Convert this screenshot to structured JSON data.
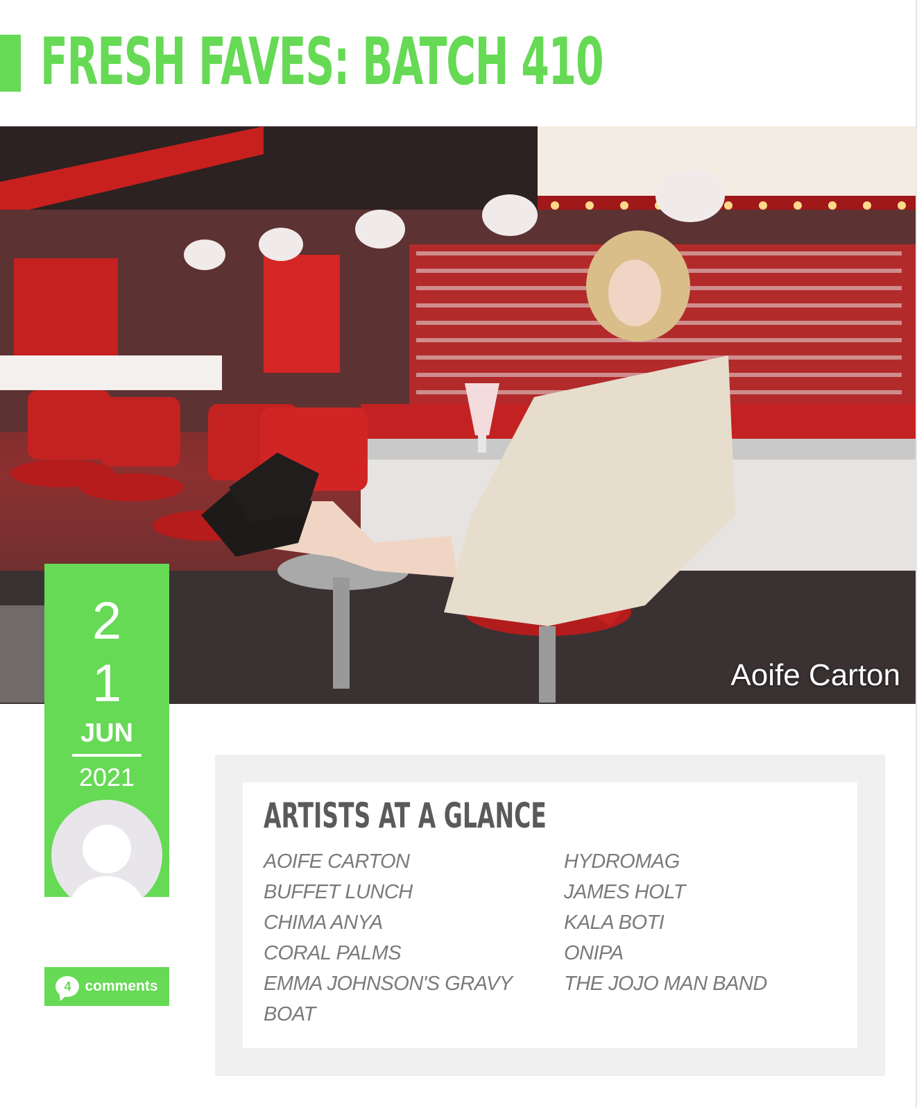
{
  "header": {
    "title": "Fresh Faves: Batch 410"
  },
  "hero": {
    "caption": "Aoife Carton"
  },
  "date": {
    "day_digit_1": "2",
    "day_digit_2": "1",
    "month": "JUN",
    "year": "2021"
  },
  "comments": {
    "count": "4",
    "label": "comments"
  },
  "artists": {
    "title": "Artists at a glance",
    "left": [
      "Aoife Carton",
      "Buffet Lunch",
      "Chima Anya",
      "Coral Palms",
      "Emma Johnson's Gravy Boat"
    ],
    "right": [
      "Hydromag",
      "James Holt",
      "Kala Boti",
      "Onipa",
      "The Jojo Man Band"
    ]
  },
  "colors": {
    "accent": "#66d955",
    "panel_bg": "#f0f0f0",
    "artist_text": "#7a7a7a"
  }
}
